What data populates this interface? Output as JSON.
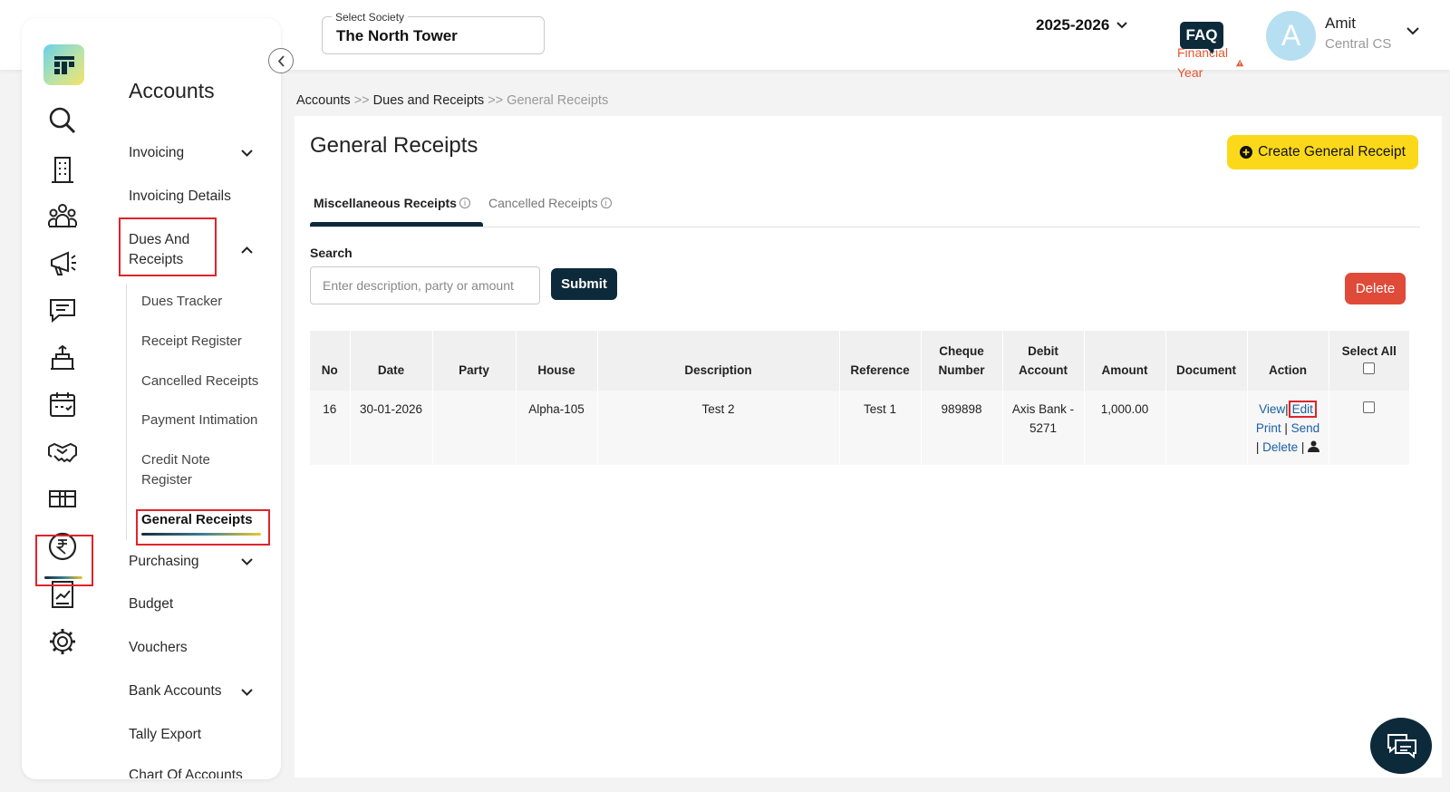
{
  "header": {
    "society_label": "Select Society",
    "society_value": "The North Tower",
    "financial_year": "2025-2026",
    "financial_year_label": "Financial Year",
    "faq_label": "FAQ",
    "avatar_letter": "A",
    "user_name": "Amit",
    "user_role": "Central CS"
  },
  "rail_icons": [
    "search-icon",
    "building-icon",
    "members-icon",
    "announcement-icon",
    "chat-icon",
    "facility-icon",
    "calendar-icon",
    "handshake-icon",
    "parcel-icon",
    "rupee-icon",
    "report-icon",
    "settings-icon"
  ],
  "menu": {
    "title": "Accounts",
    "invoicing": "Invoicing",
    "invoicing_details": "Invoicing Details",
    "dues_and_receipts": "Dues And Receipts",
    "sub_items": [
      "Dues Tracker",
      "Receipt Register",
      "Cancelled Receipts",
      "Payment Intimation",
      "Credit Note Register",
      "General Receipts"
    ],
    "purchasing": "Purchasing",
    "budget": "Budget",
    "vouchers": "Vouchers",
    "bank_accounts": "Bank Accounts",
    "tally_export": "Tally Export",
    "chart_of_accounts": "Chart Of Accounts"
  },
  "breadcrumb": {
    "item1": "Accounts",
    "sep": ">>",
    "item2": "Dues and Receipts",
    "item3": "General Receipts"
  },
  "page": {
    "title": "General Receipts",
    "create_button": "Create General Receipt",
    "tabs": [
      "Miscellaneous Receipts",
      "Cancelled Receipts"
    ],
    "search_label": "Search",
    "search_placeholder": "Enter description, party or amount",
    "submit_label": "Submit",
    "delete_label": "Delete"
  },
  "table": {
    "headers": [
      "No",
      "Date",
      "Party",
      "House",
      "Description",
      "Reference",
      "Cheque Number",
      "Debit Account",
      "Amount",
      "Document",
      "Action",
      "Select All"
    ],
    "rows": [
      {
        "no": "16",
        "date": "30-01-2026",
        "party": "",
        "house": "Alpha-105",
        "description": "Test 2",
        "reference": "Test 1",
        "cheque": "989898",
        "debit_account": "Axis Bank - 5271",
        "amount": "1,000.00",
        "document": "",
        "actions": {
          "view": "View",
          "edit": "Edit",
          "print": "Print",
          "send": "Send",
          "delete": "Delete",
          "sep": "|"
        }
      }
    ]
  },
  "colors": {
    "primary_dark": "#0d2a3b",
    "accent_yellow": "#fbd91a",
    "danger": "#e04a39",
    "link": "#1a5fa5",
    "highlight_red": "#e0242a"
  }
}
